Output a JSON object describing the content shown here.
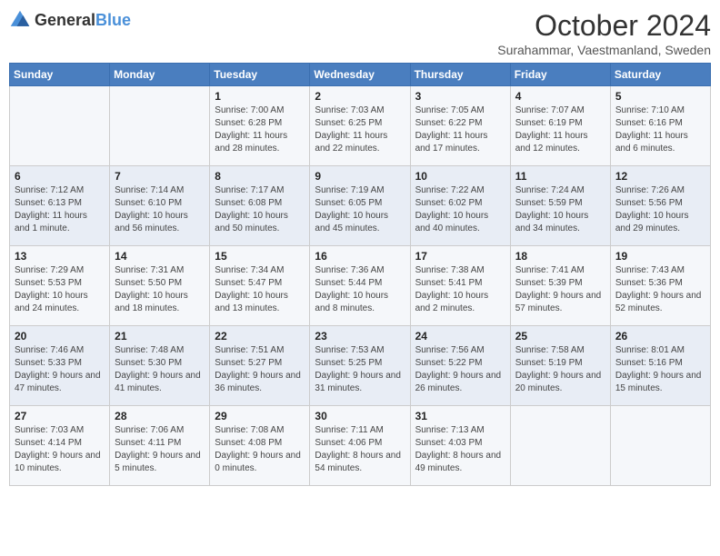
{
  "logo": {
    "general": "General",
    "blue": "Blue"
  },
  "header": {
    "month": "October 2024",
    "location": "Surahammar, Vaestmanland, Sweden"
  },
  "weekdays": [
    "Sunday",
    "Monday",
    "Tuesday",
    "Wednesday",
    "Thursday",
    "Friday",
    "Saturday"
  ],
  "weeks": [
    [
      {
        "day": "",
        "info": ""
      },
      {
        "day": "",
        "info": ""
      },
      {
        "day": "1",
        "info": "Sunrise: 7:00 AM\nSunset: 6:28 PM\nDaylight: 11 hours and 28 minutes."
      },
      {
        "day": "2",
        "info": "Sunrise: 7:03 AM\nSunset: 6:25 PM\nDaylight: 11 hours and 22 minutes."
      },
      {
        "day": "3",
        "info": "Sunrise: 7:05 AM\nSunset: 6:22 PM\nDaylight: 11 hours and 17 minutes."
      },
      {
        "day": "4",
        "info": "Sunrise: 7:07 AM\nSunset: 6:19 PM\nDaylight: 11 hours and 12 minutes."
      },
      {
        "day": "5",
        "info": "Sunrise: 7:10 AM\nSunset: 6:16 PM\nDaylight: 11 hours and 6 minutes."
      }
    ],
    [
      {
        "day": "6",
        "info": "Sunrise: 7:12 AM\nSunset: 6:13 PM\nDaylight: 11 hours and 1 minute."
      },
      {
        "day": "7",
        "info": "Sunrise: 7:14 AM\nSunset: 6:10 PM\nDaylight: 10 hours and 56 minutes."
      },
      {
        "day": "8",
        "info": "Sunrise: 7:17 AM\nSunset: 6:08 PM\nDaylight: 10 hours and 50 minutes."
      },
      {
        "day": "9",
        "info": "Sunrise: 7:19 AM\nSunset: 6:05 PM\nDaylight: 10 hours and 45 minutes."
      },
      {
        "day": "10",
        "info": "Sunrise: 7:22 AM\nSunset: 6:02 PM\nDaylight: 10 hours and 40 minutes."
      },
      {
        "day": "11",
        "info": "Sunrise: 7:24 AM\nSunset: 5:59 PM\nDaylight: 10 hours and 34 minutes."
      },
      {
        "day": "12",
        "info": "Sunrise: 7:26 AM\nSunset: 5:56 PM\nDaylight: 10 hours and 29 minutes."
      }
    ],
    [
      {
        "day": "13",
        "info": "Sunrise: 7:29 AM\nSunset: 5:53 PM\nDaylight: 10 hours and 24 minutes."
      },
      {
        "day": "14",
        "info": "Sunrise: 7:31 AM\nSunset: 5:50 PM\nDaylight: 10 hours and 18 minutes."
      },
      {
        "day": "15",
        "info": "Sunrise: 7:34 AM\nSunset: 5:47 PM\nDaylight: 10 hours and 13 minutes."
      },
      {
        "day": "16",
        "info": "Sunrise: 7:36 AM\nSunset: 5:44 PM\nDaylight: 10 hours and 8 minutes."
      },
      {
        "day": "17",
        "info": "Sunrise: 7:38 AM\nSunset: 5:41 PM\nDaylight: 10 hours and 2 minutes."
      },
      {
        "day": "18",
        "info": "Sunrise: 7:41 AM\nSunset: 5:39 PM\nDaylight: 9 hours and 57 minutes."
      },
      {
        "day": "19",
        "info": "Sunrise: 7:43 AM\nSunset: 5:36 PM\nDaylight: 9 hours and 52 minutes."
      }
    ],
    [
      {
        "day": "20",
        "info": "Sunrise: 7:46 AM\nSunset: 5:33 PM\nDaylight: 9 hours and 47 minutes."
      },
      {
        "day": "21",
        "info": "Sunrise: 7:48 AM\nSunset: 5:30 PM\nDaylight: 9 hours and 41 minutes."
      },
      {
        "day": "22",
        "info": "Sunrise: 7:51 AM\nSunset: 5:27 PM\nDaylight: 9 hours and 36 minutes."
      },
      {
        "day": "23",
        "info": "Sunrise: 7:53 AM\nSunset: 5:25 PM\nDaylight: 9 hours and 31 minutes."
      },
      {
        "day": "24",
        "info": "Sunrise: 7:56 AM\nSunset: 5:22 PM\nDaylight: 9 hours and 26 minutes."
      },
      {
        "day": "25",
        "info": "Sunrise: 7:58 AM\nSunset: 5:19 PM\nDaylight: 9 hours and 20 minutes."
      },
      {
        "day": "26",
        "info": "Sunrise: 8:01 AM\nSunset: 5:16 PM\nDaylight: 9 hours and 15 minutes."
      }
    ],
    [
      {
        "day": "27",
        "info": "Sunrise: 7:03 AM\nSunset: 4:14 PM\nDaylight: 9 hours and 10 minutes."
      },
      {
        "day": "28",
        "info": "Sunrise: 7:06 AM\nSunset: 4:11 PM\nDaylight: 9 hours and 5 minutes."
      },
      {
        "day": "29",
        "info": "Sunrise: 7:08 AM\nSunset: 4:08 PM\nDaylight: 9 hours and 0 minutes."
      },
      {
        "day": "30",
        "info": "Sunrise: 7:11 AM\nSunset: 4:06 PM\nDaylight: 8 hours and 54 minutes."
      },
      {
        "day": "31",
        "info": "Sunrise: 7:13 AM\nSunset: 4:03 PM\nDaylight: 8 hours and 49 minutes."
      },
      {
        "day": "",
        "info": ""
      },
      {
        "day": "",
        "info": ""
      }
    ]
  ]
}
